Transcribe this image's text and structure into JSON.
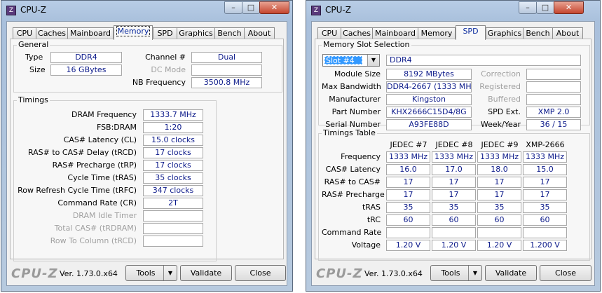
{
  "left": {
    "title": "CPU-Z",
    "tabs": [
      "CPU",
      "Caches",
      "Mainboard",
      "Memory",
      "SPD",
      "Graphics",
      "Bench",
      "About"
    ],
    "active_tab": "Memory",
    "general": {
      "label": "General",
      "type_label": "Type",
      "type_value": "DDR4",
      "size_label": "Size",
      "size_value": "16 GBytes",
      "channel_label": "Channel #",
      "channel_value": "Dual",
      "dcmode_label": "DC Mode",
      "dcmode_value": "",
      "nbfreq_label": "NB Frequency",
      "nbfreq_value": "3500.8 MHz"
    },
    "timings": {
      "label": "Timings",
      "rows": [
        {
          "label": "DRAM Frequency",
          "value": "1333.7 MHz"
        },
        {
          "label": "FSB:DRAM",
          "value": "1:20"
        },
        {
          "label": "CAS# Latency (CL)",
          "value": "15.0 clocks"
        },
        {
          "label": "RAS# to CAS# Delay (tRCD)",
          "value": "17 clocks"
        },
        {
          "label": "RAS# Precharge (tRP)",
          "value": "17 clocks"
        },
        {
          "label": "Cycle Time (tRAS)",
          "value": "35 clocks"
        },
        {
          "label": "Row Refresh Cycle Time (tRFC)",
          "value": "347 clocks"
        },
        {
          "label": "Command Rate (CR)",
          "value": "2T"
        },
        {
          "label": "DRAM Idle Timer",
          "value": ""
        },
        {
          "label": "Total CAS# (tRDRAM)",
          "value": ""
        },
        {
          "label": "Row To Column (tRCD)",
          "value": ""
        }
      ]
    },
    "footer": {
      "logo": "CPU-Z",
      "version": "Ver. 1.73.0.x64",
      "tools": "Tools",
      "validate": "Validate",
      "close": "Close"
    }
  },
  "right": {
    "title": "CPU-Z",
    "tabs": [
      "CPU",
      "Caches",
      "Mainboard",
      "Memory",
      "SPD",
      "Graphics",
      "Bench",
      "About"
    ],
    "active_tab": "SPD",
    "slot": {
      "label": "Memory Slot Selection",
      "selected": "Slot #4",
      "type": "DDR4",
      "module_size_label": "Module Size",
      "module_size": "8192 MBytes",
      "max_bw_label": "Max Bandwidth",
      "max_bw": "DDR4-2667 (1333 MHz)",
      "manufacturer_label": "Manufacturer",
      "manufacturer": "Kingston",
      "part_label": "Part Number",
      "part": "KHX2666C15D4/8G",
      "serial_label": "Serial Number",
      "serial": "A93FE88D",
      "correction_label": "Correction",
      "correction": "",
      "registered_label": "Registered",
      "registered": "",
      "buffered_label": "Buffered",
      "buffered": "",
      "spdext_label": "SPD Ext.",
      "spdext": "XMP 2.0",
      "week_label": "Week/Year",
      "week": "36 / 15"
    },
    "table": {
      "label": "Timings Table",
      "columns": [
        "JEDEC #7",
        "JEDEC #8",
        "JEDEC #9",
        "XMP-2666"
      ],
      "rows": [
        {
          "label": "Frequency",
          "values": [
            "1333 MHz",
            "1333 MHz",
            "1333 MHz",
            "1333 MHz"
          ]
        },
        {
          "label": "CAS# Latency",
          "values": [
            "16.0",
            "17.0",
            "18.0",
            "15.0"
          ]
        },
        {
          "label": "RAS# to CAS#",
          "values": [
            "17",
            "17",
            "17",
            "17"
          ]
        },
        {
          "label": "RAS# Precharge",
          "values": [
            "17",
            "17",
            "17",
            "17"
          ]
        },
        {
          "label": "tRAS",
          "values": [
            "35",
            "35",
            "35",
            "35"
          ]
        },
        {
          "label": "tRC",
          "values": [
            "60",
            "60",
            "60",
            "60"
          ]
        },
        {
          "label": "Command Rate",
          "values": [
            "",
            "",
            "",
            ""
          ]
        },
        {
          "label": "Voltage",
          "values": [
            "1.20 V",
            "1.20 V",
            "1.20 V",
            "1.200 V"
          ]
        }
      ]
    },
    "footer": {
      "logo": "CPU-Z",
      "version": "Ver. 1.73.0.x64",
      "tools": "Tools",
      "validate": "Validate",
      "close": "Close"
    }
  }
}
